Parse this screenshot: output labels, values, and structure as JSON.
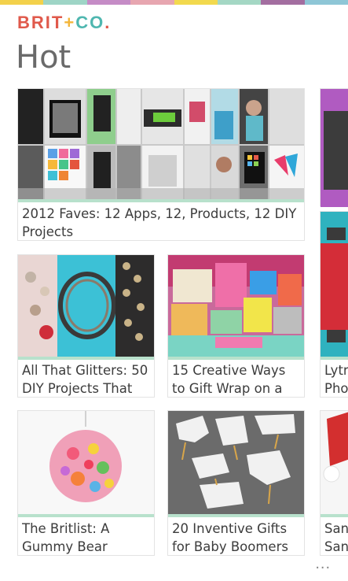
{
  "app": {
    "logo_text": "BRIT+CO.",
    "page_title": "Hot"
  },
  "top_stripe_colors": [
    "#f3d14b",
    "#9ed5c6",
    "#c58cc6",
    "#e7a6b0",
    "#f2d94e",
    "#a4d7c4",
    "#a36ea0",
    "#8ec6d6"
  ],
  "tiles": [
    {
      "caption": "2012 Faves: 12 Apps, 12, Products, 12 DIY Projects"
    },
    {
      "caption": "All That Glitters: 50 DIY Projects That"
    },
    {
      "caption": "15 Creative Ways to Gift Wrap on a"
    },
    {
      "caption": "The Britlist: A Gummy Bear Chandelier, The"
    },
    {
      "caption": "20 Inventive Gifts for Baby Boomers"
    },
    {
      "caption": "Lytro Pho"
    },
    {
      "caption": "San San"
    }
  ],
  "more_menu": "..."
}
